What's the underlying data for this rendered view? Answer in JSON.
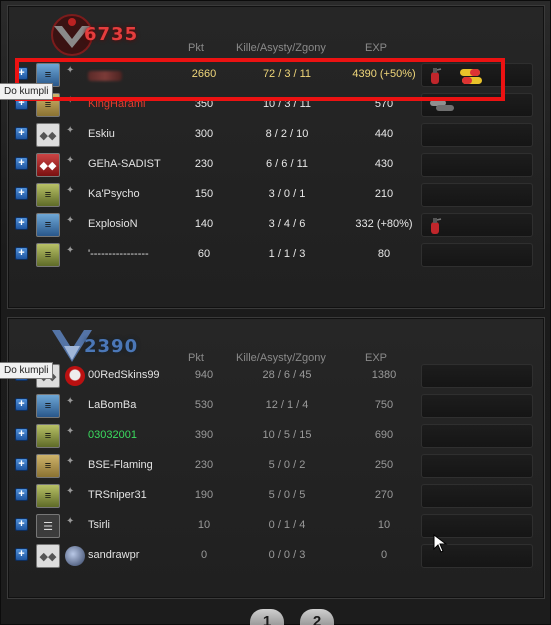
{
  "columns": {
    "pkt": "Pkt",
    "kad": "Kille/Asysty/Zgony",
    "exp": "EXP"
  },
  "tooltip": "Do kumpli",
  "red_team": {
    "score": "6735",
    "players": [
      {
        "rank": "blue",
        "name": "",
        "blurred": true,
        "pkt": "2660",
        "kad": "72 / 3 / 11",
        "exp": "4390 (+50%)",
        "items": [
          "fire-extinguisher",
          "capsules"
        ]
      },
      {
        "rank": "gold",
        "name": "KingHarami",
        "color": "red",
        "pkt": "350",
        "kad": "10 / 3 / 11",
        "exp": "570",
        "items": [
          "grenades"
        ]
      },
      {
        "rank": "silver",
        "name": "Eskiu",
        "pkt": "300",
        "kad": "8 / 2 / 10",
        "exp": "440",
        "items": []
      },
      {
        "rank": "red",
        "name": "GEhA-SADIST",
        "pkt": "230",
        "kad": "6 / 6 / 11",
        "exp": "430",
        "items": []
      },
      {
        "rank": "green",
        "name": "Ka'Psycho",
        "pkt": "150",
        "kad": "3 / 0 / 1",
        "exp": "210",
        "items": []
      },
      {
        "rank": "blue",
        "name": "ExplosioN",
        "pkt": "140",
        "kad": "3 / 4 / 6",
        "exp": "332 (+80%)",
        "items": [
          "fire-extinguisher"
        ]
      },
      {
        "rank": "green",
        "name": "'----------------",
        "pkt": "60",
        "kad": "1 / 1 / 3",
        "exp": "80",
        "items": []
      }
    ]
  },
  "blue_team": {
    "score": "2390",
    "players": [
      {
        "rank": "silver",
        "name": "00RedSkins99",
        "avatar": "skull",
        "pkt": "940",
        "kad": "28 / 6 / 45",
        "exp": "1380"
      },
      {
        "rank": "blue",
        "name": "LaBomBa",
        "pkt": "530",
        "kad": "12 / 1 / 4",
        "exp": "750"
      },
      {
        "rank": "green",
        "name": "03032001",
        "color": "green",
        "pkt": "390",
        "kad": "10 / 5 / 15",
        "exp": "690"
      },
      {
        "rank": "gold",
        "name": "BSE-Flaming",
        "pkt": "230",
        "kad": "5 / 0 / 2",
        "exp": "250"
      },
      {
        "rank": "green",
        "name": "TRSniper31",
        "pkt": "190",
        "kad": "5 / 0 / 5",
        "exp": "270"
      },
      {
        "rank": "dark",
        "name": "Tsirli",
        "pkt": "10",
        "kad": "0 / 1 / 4",
        "exp": "10"
      },
      {
        "rank": "silver",
        "name": "sandrawpr",
        "avatar": "globe",
        "pkt": "0",
        "kad": "0 / 0 / 3",
        "exp": "0"
      }
    ]
  },
  "pages": [
    "1",
    "2"
  ]
}
